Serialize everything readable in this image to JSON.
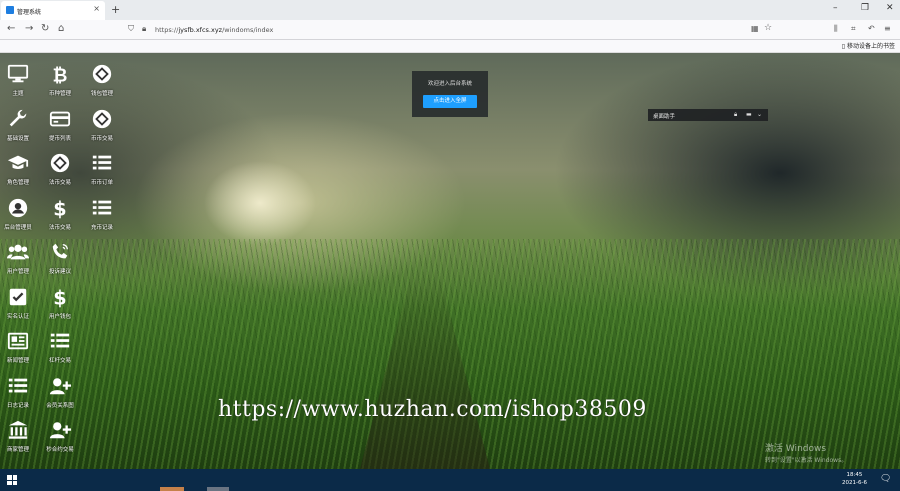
{
  "browser": {
    "tab_title": "管理系统",
    "tab_close": "×",
    "new_tab": "+",
    "url_prefix": "https://",
    "url_domain": "jysfb.xfcs.xyz",
    "url_path": "/windoms/index",
    "bookmark_bar_text": "移动设备上的书签",
    "window_controls": {
      "minimize": "–",
      "restore": "❐",
      "close": "✕"
    }
  },
  "desktop_icons": [
    {
      "label": "主题",
      "icon": "monitor-icon"
    },
    {
      "label": "币种管理",
      "icon": "bitcoin-icon"
    },
    {
      "label": "钱包管理",
      "icon": "exchange-circle-icon"
    },
    {
      "label": "基础设置",
      "icon": "wrench-icon"
    },
    {
      "label": "提币列表",
      "icon": "credit-card-icon"
    },
    {
      "label": "币币交易",
      "icon": "exchange-circle-icon"
    },
    {
      "label": "角色管理",
      "icon": "graduation-cap-icon"
    },
    {
      "label": "法币交易",
      "icon": "exchange-circle-icon"
    },
    {
      "label": "币币订单",
      "icon": "list-icon"
    },
    {
      "label": "后台管理员",
      "icon": "user-circle-icon"
    },
    {
      "label": "法币交易",
      "icon": "dollar-icon"
    },
    {
      "label": "充币记录",
      "icon": "list-icon"
    },
    {
      "label": "用户管理",
      "icon": "users-icon"
    },
    {
      "label": "投诉建议",
      "icon": "phone-icon"
    },
    {
      "label": "实名认证",
      "icon": "check-square-icon"
    },
    {
      "label": "用户钱包",
      "icon": "dollar-icon"
    },
    {
      "label": "新闻管理",
      "icon": "newspaper-icon"
    },
    {
      "label": "杠杆交易",
      "icon": "list-icon"
    },
    {
      "label": "日志记录",
      "icon": "list-icon"
    },
    {
      "label": "会员关系图",
      "icon": "user-plus-icon"
    },
    {
      "label": "商家管理",
      "icon": "bank-icon"
    },
    {
      "label": "秒合约交易",
      "icon": "user-plus-icon"
    }
  ],
  "welcome": {
    "message": "欢迎进入后台系统",
    "button": "点击进入全屏"
  },
  "music_bar": {
    "title": "桌面助手"
  },
  "watermark": "https://www.huzhan.com/ishop38509",
  "activation": {
    "line1": "激活 Windows",
    "line2": "转到\"设置\"以激活 Windows。"
  },
  "taskbar": {
    "time": "18:45",
    "date": "2021-6-6"
  }
}
